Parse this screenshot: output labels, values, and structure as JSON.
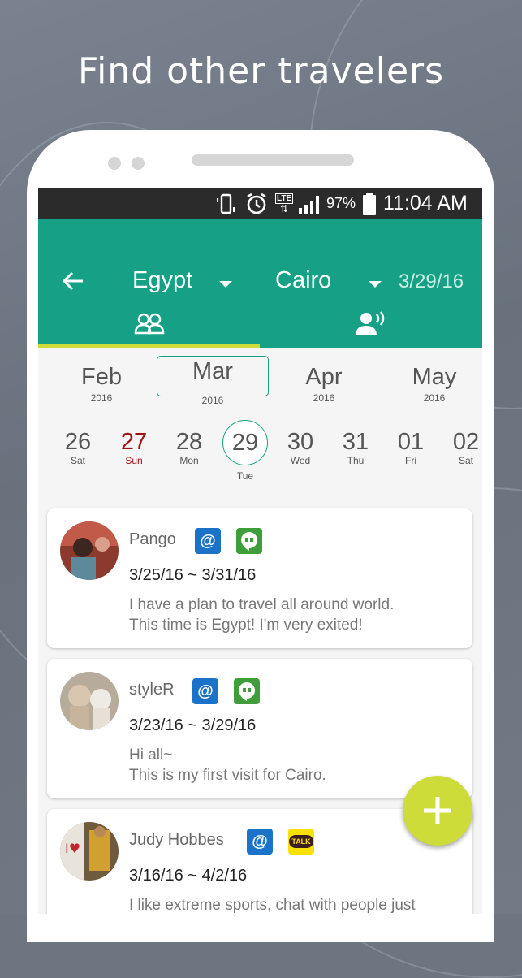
{
  "headline": "Find other travelers",
  "status_bar": {
    "lte": "LTE",
    "battery": "97%",
    "time": "11:04 AM"
  },
  "app_bar": {
    "country": "Egypt",
    "city": "Cairo",
    "date": "3/29/16"
  },
  "tabs": [
    {
      "icon": "people-icon",
      "selected": true
    },
    {
      "icon": "speaking-person-icon",
      "selected": false
    }
  ],
  "months": [
    {
      "name": "Feb",
      "year": "2016"
    },
    {
      "name": "Mar",
      "year": "2016",
      "selected": true
    },
    {
      "name": "Apr",
      "year": "2016"
    },
    {
      "name": "May",
      "year": "2016"
    }
  ],
  "days": [
    {
      "num": "26",
      "wd": "Sat"
    },
    {
      "num": "27",
      "wd": "Sun"
    },
    {
      "num": "28",
      "wd": "Mon"
    },
    {
      "num": "29",
      "wd": "Tue",
      "selected": true
    },
    {
      "num": "30",
      "wd": "Wed"
    },
    {
      "num": "31",
      "wd": "Thu"
    },
    {
      "num": "01",
      "wd": "Fri"
    },
    {
      "num": "02",
      "wd": "Sat"
    }
  ],
  "posts": [
    {
      "name": "Pango",
      "dates": "3/25/16 ~ 3/31/16",
      "line1": "I have a plan to travel all around world.",
      "line2": "This time is Egypt! I'm very exited!",
      "contact": "hangouts"
    },
    {
      "name": "styleR",
      "dates": "3/23/16 ~ 3/29/16",
      "line1": "Hi all~",
      "line2": "This is my first visit for Cairo.",
      "contact": "hangouts"
    },
    {
      "name": "Judy Hobbes",
      "dates": "3/16/16 ~ 4/2/16",
      "line1": "I like extreme sports, chat with people just",
      "line2": "",
      "contact": "kakaotalk",
      "talk_label": "TALK"
    }
  ],
  "colors": {
    "primary": "#16a085",
    "accent": "#cddc39",
    "sunday": "#a01010"
  }
}
